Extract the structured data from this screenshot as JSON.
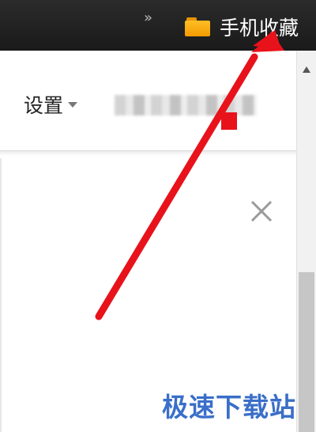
{
  "bookmarks_bar": {
    "overflow_icon": "chevron-double-right-icon",
    "folder": {
      "icon": "folder-icon",
      "label": "手机收藏",
      "color": "#f5a300"
    }
  },
  "toolbar": {
    "settings_label": "设置",
    "settings_icon": "caret-down-icon",
    "blurred_link_label": ""
  },
  "dialog": {
    "close_icon": "close-icon"
  },
  "scrollbar": {
    "up_icon": "arrow-up-icon"
  },
  "annotation": {
    "type": "arrow",
    "color": "#e8121b"
  },
  "watermark": {
    "text": "极速下载站",
    "color": "#3a6fc9"
  }
}
